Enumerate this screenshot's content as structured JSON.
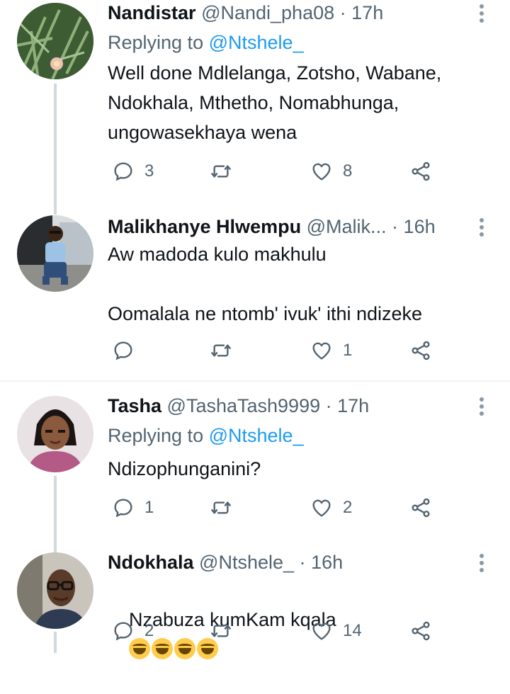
{
  "tweets": [
    {
      "name": "Nandistar",
      "handle": "@Nandi_pha08",
      "time": "17h",
      "replying_label": "Replying to",
      "replying_to": "@Ntshele_",
      "text": "Well done Mdlelanga, Zotsho, Wabane, Ndokhala, Mthetho, Nomabhunga, ungowasekhaya wena",
      "replies": "3",
      "retweets": "",
      "likes": "8"
    },
    {
      "name": "Malikhanye Hlwempu",
      "handle": "@Malik...",
      "time": "16h",
      "text": "Aw madoda kulo makhulu\n\nOomalala ne ntomb' ivuk' ithi ndizeke",
      "replies": "",
      "retweets": "",
      "likes": "1"
    },
    {
      "name": "Tasha",
      "handle": "@TashaTash9999",
      "time": "17h",
      "replying_label": "Replying to",
      "replying_to": "@Ntshele_",
      "text": "Ndizophunganini?",
      "replies": "1",
      "retweets": "",
      "likes": "2"
    },
    {
      "name": "Ndokhala",
      "handle": "@Ntshele_",
      "time": "16h",
      "text": "Nzabuza kumKam kqala",
      "emoji": "rolling-on-floor-laughing x4",
      "replies": "2",
      "retweets": "",
      "likes": "14"
    }
  ],
  "separator": "·",
  "colors": {
    "accent": "#1d9bf0",
    "secondary": "#536471",
    "thread_line": "#cfd9de",
    "divider": "#eff3f4"
  },
  "icons": [
    "reply-icon",
    "retweet-icon",
    "like-icon",
    "share-icon",
    "more-icon"
  ]
}
